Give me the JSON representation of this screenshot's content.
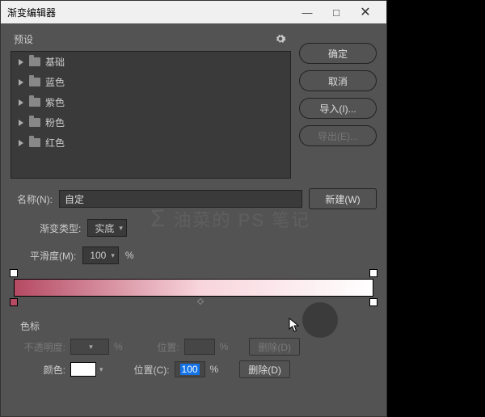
{
  "titlebar": {
    "title": "渐变编辑器"
  },
  "presets": {
    "label": "预设",
    "folders": [
      "基础",
      "蓝色",
      "紫色",
      "粉色",
      "红色"
    ]
  },
  "buttons": {
    "ok": "确定",
    "cancel": "取消",
    "import": "导入(I)...",
    "export": "导出(E)..."
  },
  "name": {
    "label": "名称(N):",
    "value": "自定",
    "new": "新建(W)"
  },
  "gradient": {
    "type_label": "渐变类型:",
    "type_value": "实底",
    "smooth_label": "平滑度(M):",
    "smooth_value": "100",
    "pct": "%"
  },
  "stops": {
    "section": "色标",
    "opacity_label": "不透明度:",
    "position_label": "位置:",
    "position2_label": "位置(C):",
    "position2_value": "100",
    "delete": "删除(D)",
    "color_label": "颜色:"
  },
  "watermark": "油菜的 PS 笔记"
}
